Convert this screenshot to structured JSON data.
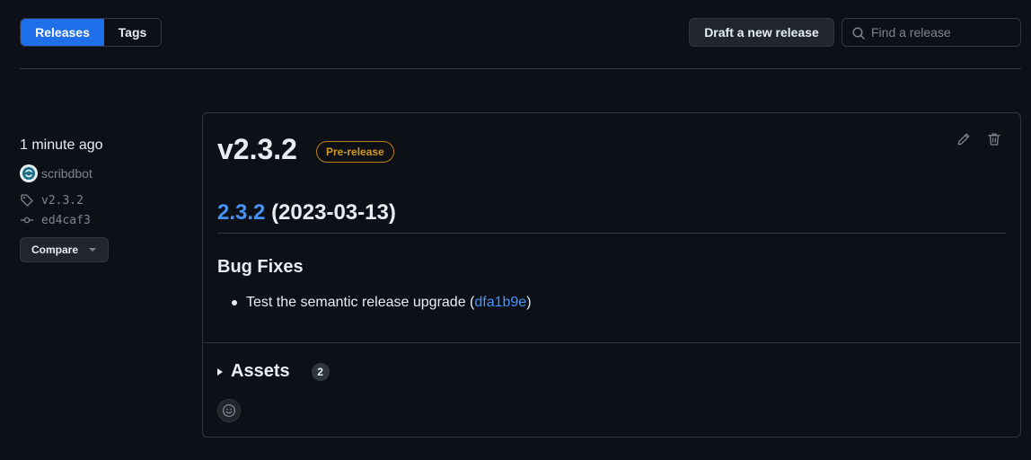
{
  "tabs": {
    "releases": "Releases",
    "tags": "Tags"
  },
  "toolbar": {
    "draft_label": "Draft a new release",
    "search_placeholder": "Find a release"
  },
  "meta": {
    "time": "1 minute ago",
    "author": "scribdbot",
    "tag": "v2.3.2",
    "commit": "ed4caf3",
    "compare_label": "Compare"
  },
  "release": {
    "title": "v2.3.2",
    "badge": "Pre-release",
    "version_link": "2.3.2",
    "date": "(2023-03-13)",
    "section_heading": "Bug Fixes",
    "fix_text": "Test the semantic release upgrade (",
    "fix_commit": "dfa1b9e",
    "fix_close": ")",
    "assets_label": "Assets",
    "assets_count": "2"
  },
  "colors": {
    "accent": "#1f6feb",
    "link": "#4493f8",
    "prerelease": "#d29922",
    "bg": "#0d1117"
  }
}
